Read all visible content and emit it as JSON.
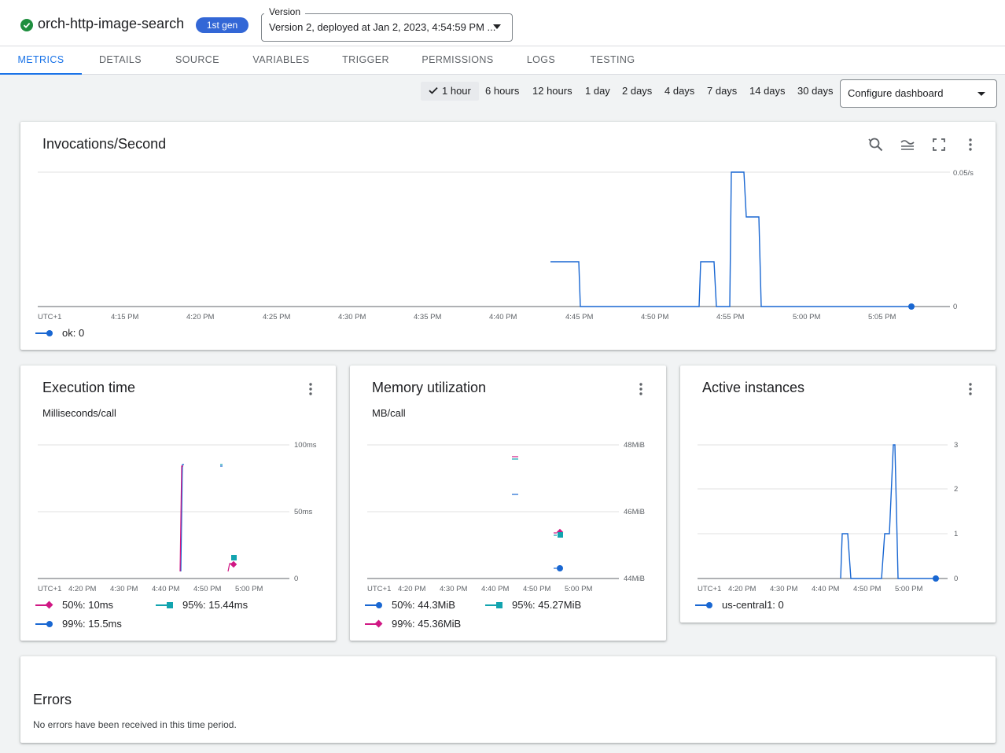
{
  "header": {
    "function_name": "orch-http-image-search",
    "gen_badge": "1st gen",
    "version_label": "Version",
    "version_value": "Version 2, deployed at Jan 2, 2023, 4:54:59 PM ..."
  },
  "tabs": [
    "METRICS",
    "DETAILS",
    "SOURCE",
    "VARIABLES",
    "TRIGGER",
    "PERMISSIONS",
    "LOGS",
    "TESTING"
  ],
  "time_ranges": [
    "1 hour",
    "6 hours",
    "12 hours",
    "1 day",
    "2 days",
    "4 days",
    "7 days",
    "14 days",
    "30 days"
  ],
  "selected_range": "1 hour",
  "configure_dashboard": "Configure dashboard",
  "colors": {
    "blue": "#1967d2",
    "magenta": "#c5221f",
    "pink": "#d01884",
    "teal": "#12a4af",
    "accent": "#1a73e8"
  },
  "invocations": {
    "title": "Invocations/Second",
    "y_top_label": "0.05/s",
    "y_zero_label": "0",
    "x_labels": [
      "UTC+1",
      "4:15 PM",
      "4:20 PM",
      "4:25 PM",
      "4:30 PM",
      "4:35 PM",
      "4:40 PM",
      "4:45 PM",
      "4:50 PM",
      "4:55 PM",
      "5:00 PM",
      "5:05 PM"
    ],
    "legend": [
      {
        "label": "ok: 0",
        "color": "#1967d2"
      }
    ]
  },
  "execution": {
    "title": "Execution time",
    "subtitle": "Milliseconds/call",
    "y_labels": [
      "100ms",
      "50ms",
      "0"
    ],
    "x_labels": [
      "UTC+1",
      "4:20 PM",
      "4:30 PM",
      "4:40 PM",
      "4:50 PM",
      "5:00 PM"
    ],
    "legend": [
      {
        "label": "50%: 10ms",
        "color": "#d01884",
        "marker": "diamond"
      },
      {
        "label": "95%: 15.44ms",
        "color": "#12a4af",
        "marker": "square"
      },
      {
        "label": "99%: 15.5ms",
        "color": "#1967d2",
        "marker": "circle"
      }
    ]
  },
  "memory": {
    "title": "Memory utilization",
    "subtitle": "MB/call",
    "y_labels": [
      "48MiB",
      "46MiB",
      "44MiB"
    ],
    "x_labels": [
      "UTC+1",
      "4:20 PM",
      "4:30 PM",
      "4:40 PM",
      "4:50 PM",
      "5:00 PM"
    ],
    "legend": [
      {
        "label": "50%: 44.3MiB",
        "color": "#1967d2",
        "marker": "circle"
      },
      {
        "label": "95%: 45.27MiB",
        "color": "#12a4af",
        "marker": "square"
      },
      {
        "label": "99%: 45.36MiB",
        "color": "#d01884",
        "marker": "diamond"
      }
    ]
  },
  "instances": {
    "title": "Active instances",
    "y_labels": [
      "3",
      "2",
      "1",
      "0"
    ],
    "x_labels": [
      "UTC+1",
      "4:20 PM",
      "4:30 PM",
      "4:40 PM",
      "4:50 PM",
      "5:00 PM"
    ],
    "legend": [
      {
        "label": "us-central1: 0",
        "color": "#1967d2",
        "marker": "circle"
      }
    ]
  },
  "errors": {
    "title": "Errors",
    "message": "No errors have been received in this time period."
  }
}
